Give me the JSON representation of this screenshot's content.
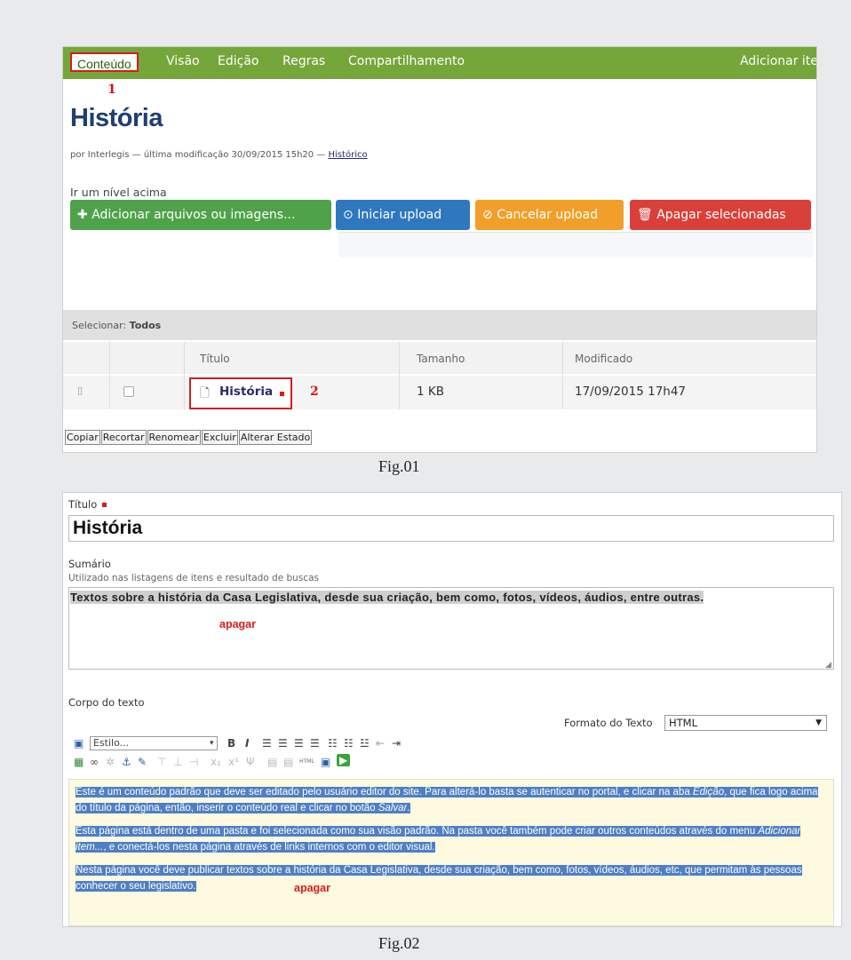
{
  "fig1": {
    "tabs": [
      "Conteúdo",
      "Visão",
      "Edição",
      "Regras",
      "Compartilhamento"
    ],
    "add_item": "Adicionar ite",
    "marker1": "1",
    "marker2": "2",
    "page_title": "História",
    "byline_prefix": "por Interlegis — última modificação 30/09/2015 15h20 —",
    "byline_link": "Histórico",
    "up_level": "Ir um nível acima",
    "buttons": {
      "add": "Adicionar arquivos ou imagens...",
      "start": "Iniciar upload",
      "cancel": "Cancelar upload",
      "delete": "Apagar selecionadas"
    },
    "select_label": "Selecionar:",
    "select_all": "Todos",
    "columns": [
      "Título",
      "Tamanho",
      "Modificado"
    ],
    "row": {
      "title": "História",
      "size": "1 KB",
      "modified": "17/09/2015 17h47"
    },
    "actions": [
      "Copiar",
      "Recortar",
      "Renomear",
      "Excluir",
      "Alterar Estado"
    ],
    "caption": "Fig.01"
  },
  "fig2": {
    "title_label": "Título",
    "title_value": "História",
    "summary_label": "Sumário",
    "summary_help": "Utilizado nas listagens de itens e resultado de buscas",
    "summary_value": "Textos sobre a história da Casa Legislativa, desde sua criação, bem como, fotos, vídeos, áudios, entre outras.",
    "apagar": "apagar",
    "body_label": "Corpo do texto",
    "format_label": "Formato do Texto",
    "format_value": "HTML",
    "style_placeholder": "Estilo...",
    "para1_a": "Este é um conteúdo padrão que deve ser editado pelo usuário editor do site. Para alterá-lo basta se autenticar no portal, e clicar na aba ",
    "para1_em": "Edição",
    "para1_b": ", que fica logo acima do título da página, então, inserir o conteúdo real e clicar no botão ",
    "para1_em2": "Salvar",
    "para1_c": ".",
    "para2_a": "Esta página está dentro de uma pasta e foi selecionada como sua visão padrão. Na pasta você também pode criar outros conteúdos através do menu ",
    "para2_em": "Adicionar item...",
    "para2_b": ", e conectá-los nesta página através de links internos com o editor visual.",
    "para3": "Nesta página você deve publicar textos sobre a história da Casa Legislativa, desde sua criação, bem como, fotos, vídeos, áudios, etc, que permitam às pessoas conhecer o seu legislativo.",
    "caption": "Fig.02"
  },
  "colors": {
    "tabbar": "#74a63a",
    "title": "#1f3f73",
    "highlight": "#4f7fc4",
    "marker": "#d71c1c"
  }
}
